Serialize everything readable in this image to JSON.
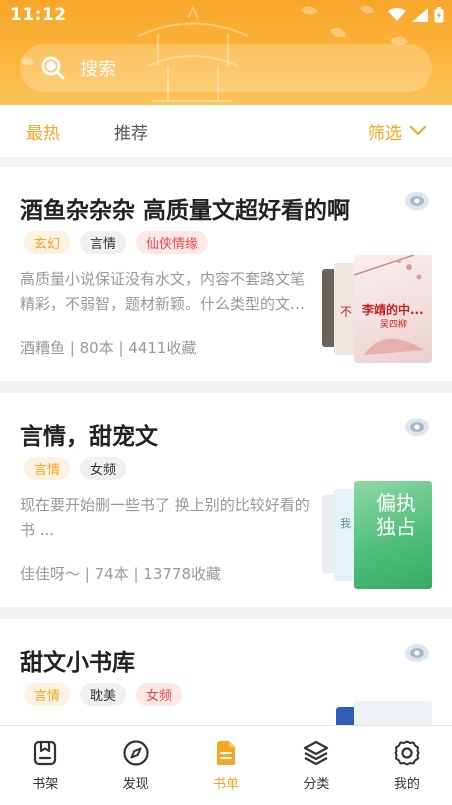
{
  "status_bar": {
    "time": "11:12"
  },
  "search": {
    "placeholder": "搜索"
  },
  "filter_bar": {
    "tabs": [
      {
        "label": "最热",
        "active": true
      },
      {
        "label": "推荐",
        "active": false
      }
    ],
    "filter_label": "筛选"
  },
  "cards": [
    {
      "title": "酒鱼杂杂杂 高质量文超好看的啊",
      "tags": [
        {
          "label": "玄幻",
          "style": "orange"
        },
        {
          "label": "言情",
          "style": "gray"
        },
        {
          "label": "仙侠情缘",
          "style": "red"
        }
      ],
      "description": "高质量小说保证没有水文，内容不套路文笔精彩，不弱智，题材新颖。什么类型的文都...",
      "author": "酒糟鱼",
      "book_count": "80本",
      "favorites": "4411收藏",
      "cover_text": {
        "front_title": "李靖的中...",
        "front_author": "吴四柳",
        "back_fragment": "不"
      }
    },
    {
      "title": "言情，甜宠文",
      "tags": [
        {
          "label": "言情",
          "style": "orange"
        },
        {
          "label": "女频",
          "style": "gray"
        }
      ],
      "description": "现在要开始删一些书了 换上别的比较好看的书 ...",
      "author": "佳佳呀～",
      "book_count": "74本",
      "favorites": "13778收藏",
      "cover_text": {
        "front_title": "偏执独占",
        "back_fragment": "我"
      }
    },
    {
      "title": "甜文小书库",
      "tags": [
        {
          "label": "言情",
          "style": "orange"
        },
        {
          "label": "耽美",
          "style": "gray"
        },
        {
          "label": "女频",
          "style": "red"
        }
      ]
    }
  ],
  "bottom_nav": [
    {
      "label": "书架",
      "icon": "bookshelf-icon",
      "active": false
    },
    {
      "label": "发现",
      "icon": "compass-icon",
      "active": false
    },
    {
      "label": "书单",
      "icon": "booklist-icon",
      "active": true
    },
    {
      "label": "分类",
      "icon": "layers-icon",
      "active": false
    },
    {
      "label": "我的",
      "icon": "gear-icon",
      "active": false
    }
  ],
  "colors": {
    "accent": "#f5a623",
    "header_top": "#f7a62a",
    "tag_red": "#f04848"
  }
}
